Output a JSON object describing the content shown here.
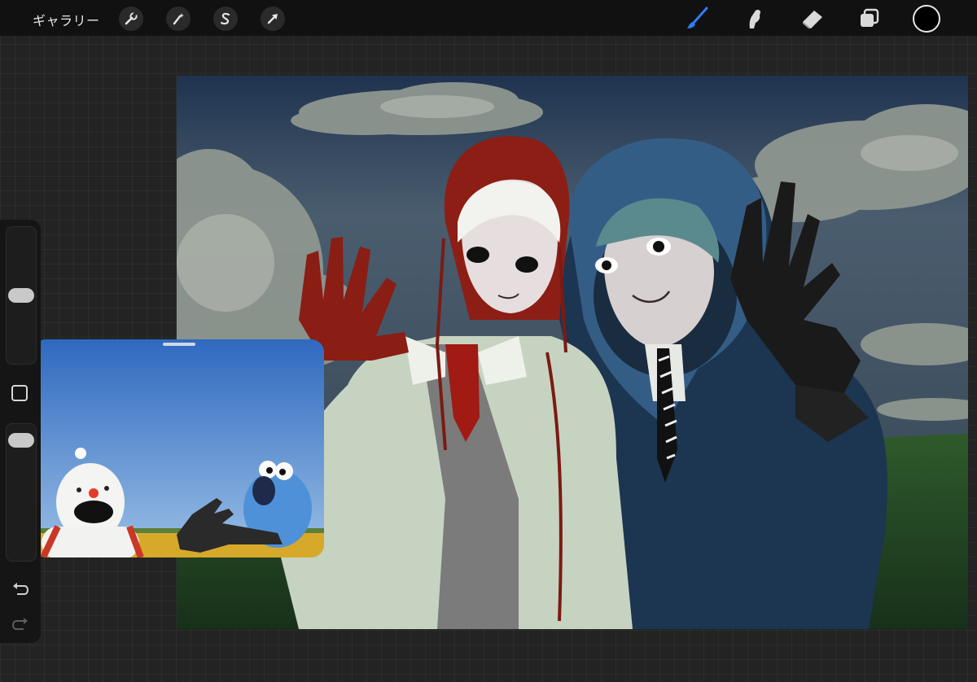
{
  "topbar": {
    "gallery_label": "ギャラリー",
    "left_tools": [
      {
        "name": "wrench-icon",
        "label": "actions"
      },
      {
        "name": "magic-wand-icon",
        "label": "adjustments"
      },
      {
        "name": "selection-s-icon",
        "label": "selection"
      },
      {
        "name": "arrow-cursor-icon",
        "label": "transform"
      }
    ],
    "right_tools": [
      {
        "name": "brush-icon",
        "label": "brush",
        "active": true
      },
      {
        "name": "smudge-icon",
        "label": "smudge"
      },
      {
        "name": "eraser-icon",
        "label": "eraser"
      },
      {
        "name": "layers-icon",
        "label": "layers"
      }
    ],
    "active_color": "#000000",
    "accent_color": "#2f7cf6"
  },
  "sidebar": {
    "brush_size_level": 0.5,
    "opacity_level": 0.95,
    "icons": [
      "modify-square-icon",
      "undo-icon",
      "redo-icon"
    ]
  },
  "reference": {
    "title": ""
  }
}
